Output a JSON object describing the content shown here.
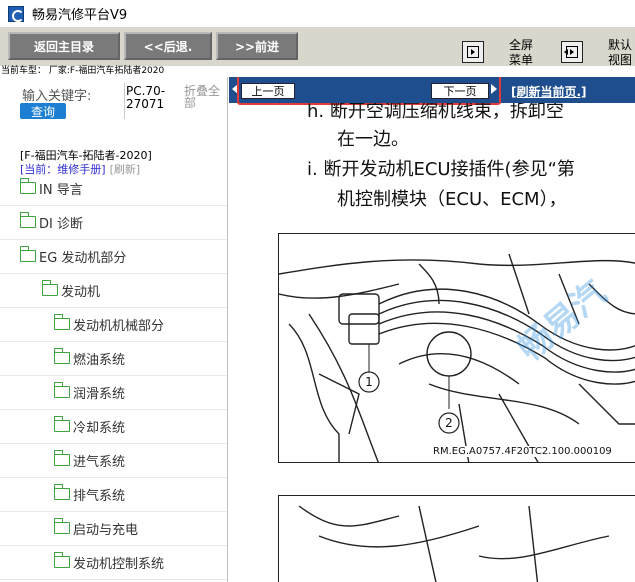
{
  "window": {
    "title": "畅易汽修平台V9"
  },
  "toolbar": {
    "home_label": "返回主目录",
    "back_label": "<<后退.",
    "forward_label": ">>前进",
    "fullscreen_label": "全屏\n菜单",
    "default_view_label": "默认\n视图"
  },
  "vehicle_bar": {
    "text": "当前车型：  厂家:F-福田汽车拓陆者2020"
  },
  "sidebar": {
    "search_label": "输入关键字:",
    "search_button": "查询",
    "code": "PC.70-27071",
    "collapse_label": "折叠全部",
    "vehicle_title": "[F-福田汽车-拓陆者-2020]",
    "current_label": "[当前：维修手册]",
    "refresh_label": "[刷新]",
    "tree": [
      {
        "label": "IN 导言"
      },
      {
        "label": "DI 诊断"
      },
      {
        "label": "EG 发动机部分"
      },
      {
        "label": "发动机"
      },
      {
        "label": "发动机机械部分"
      },
      {
        "label": "燃油系统"
      },
      {
        "label": "润滑系统"
      },
      {
        "label": "冷却系统"
      },
      {
        "label": "进气系统"
      },
      {
        "label": "排气系统"
      },
      {
        "label": "启动与充电"
      },
      {
        "label": "发动机控制系统"
      }
    ]
  },
  "content": {
    "prev_page": "上一页",
    "next_page": "下一页",
    "refresh_page": "[刷新当前页.]",
    "lines": [
      "h.  断开空调压缩机线束，拆卸空",
      "在一边。",
      "i.  断开发动机ECU接插件(参见“第",
      "机控制模块（ECU、ECM），"
    ],
    "figure_caption": "RM.EG.A0757.4F20TC2.100.000109",
    "callouts": [
      "1",
      "2"
    ],
    "watermark": "畅易汽"
  },
  "colors": {
    "toolbar_bg": "#d9d6cc",
    "nav_bar": "#1e4e8e",
    "highlight": "#e03a3a",
    "folder_green": "#3fa33f",
    "search_blue": "#1d7fd1"
  }
}
